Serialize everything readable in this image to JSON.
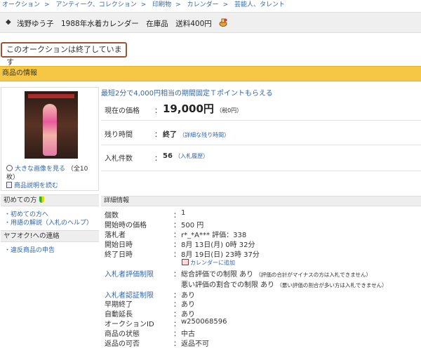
{
  "breadcrumb": [
    "オークション",
    "アンティーク、コレクション",
    "印刷物",
    "カレンダー",
    "芸能人、タレント"
  ],
  "title": {
    "bullet": "◆",
    "text": "浅野ゆう子　1988年水着カレンダー　在庫品　送料400円"
  },
  "ended_banner": "このオークションは終了しています",
  "product_info_header": "商品の情報",
  "image_links": {
    "enlarge": "大きな画像を見る",
    "count": "（全10",
    "count_cont": "枚）",
    "description": "商品説明を読む"
  },
  "promo": "最短2分で4,000円相当の期間固定Ｔポイントもらえる",
  "price": {
    "label": "現在の価格",
    "value": "19,000円",
    "tax": "（税0円）"
  },
  "time_left": {
    "label": "残り時間",
    "value": "終了",
    "link": "（詳細な残り時間）"
  },
  "bids": {
    "label": "入札件数",
    "value": "56",
    "link": "（入札履歴）"
  },
  "sidebar": {
    "beginners": {
      "header": "初めての方",
      "items": [
        "初めての方へ",
        "用語の解説（入札のヘルプ）"
      ]
    },
    "contact": {
      "header": "ヤフオク!への連絡",
      "items": [
        "違反商品の申告"
      ]
    }
  },
  "details_header": "詳細情報",
  "colon": "：",
  "details": [
    {
      "label": "個数",
      "value": "1"
    },
    {
      "label": "開始時の価格",
      "value": "500 円"
    },
    {
      "label": "落札者",
      "value": "r*_*A*** 評価：338"
    },
    {
      "label": "開始日時",
      "value": "8月 13日(月) 0時 32分"
    },
    {
      "label": "終了日時",
      "value": "8月 19日(日) 23時 37分"
    }
  ],
  "calendar_link": "カレンダーに追加",
  "eval_limit": {
    "label": "入札者評価制限",
    "line1": "総合評価での制限 あり",
    "line1_note": "（評価の合計がマイナスの方は入札できません）",
    "line2": "悪い評価の割合での制限 あり",
    "line2_note": "（悪い評価の割合が多い方は入札できません）"
  },
  "details2": [
    {
      "label": "入札者認証制限",
      "value": "あり",
      "link": true
    },
    {
      "label": "早期終了",
      "value": "あり",
      "link": false
    },
    {
      "label": "自動延長",
      "value": "あり",
      "link": false
    },
    {
      "label": "オークションID",
      "value": "w250068596",
      "link": false
    },
    {
      "label": "商品の状態",
      "value": "中古",
      "link": false
    },
    {
      "label": "返品の可否",
      "value": "返品不可",
      "link": false
    }
  ]
}
